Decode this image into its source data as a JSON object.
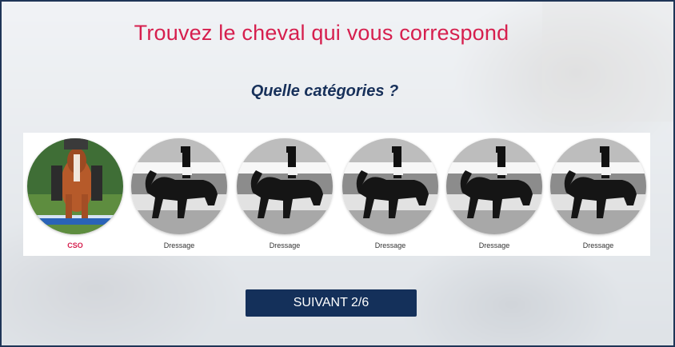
{
  "page": {
    "title": "Trouvez le cheval qui vous correspond",
    "question": "Quelle catégories ?"
  },
  "categories": [
    {
      "label": "CSO",
      "image": "show-jumping-horse-photo",
      "selected": true
    },
    {
      "label": "Dressage",
      "image": "dressage-horse-photo",
      "selected": false
    },
    {
      "label": "Dressage",
      "image": "dressage-horse-photo",
      "selected": false
    },
    {
      "label": "Dressage",
      "image": "dressage-horse-photo",
      "selected": false
    },
    {
      "label": "Dressage",
      "image": "dressage-horse-photo",
      "selected": false
    },
    {
      "label": "Dressage",
      "image": "dressage-horse-photo",
      "selected": false
    }
  ],
  "actions": {
    "next_label": "SUIVANT 2/6"
  },
  "colors": {
    "accent": "#d61f4e",
    "primary": "#14305a",
    "heading": "#17305a"
  }
}
